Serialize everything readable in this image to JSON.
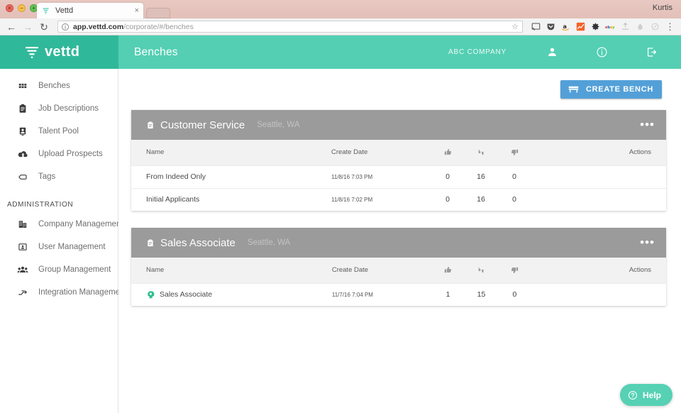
{
  "browser": {
    "profile_name": "Kurtis",
    "tab": {
      "title": "Vettd",
      "close_label": "×",
      "favicon": "vettd-favicon"
    },
    "new_tab_label": "",
    "nav": {
      "back": "←",
      "forward": "→",
      "reload": "↻"
    },
    "omnibox": {
      "info_label": "ⓘ",
      "url_host": "app.vettd.com",
      "url_path": "/corporate/#/benches",
      "star": "☆"
    },
    "extensions": [
      {
        "name": "cast-icon",
        "glyph": "ᵛ"
      },
      {
        "name": "pocket-icon",
        "glyph": "▼"
      },
      {
        "name": "amazon-icon",
        "glyph": "a"
      },
      {
        "name": "analytics-icon",
        "glyph": "↗"
      },
      {
        "name": "gear-icon",
        "glyph": "⚙"
      },
      {
        "name": "ebay-icon",
        "glyph": "ebay"
      },
      {
        "name": "upload-icon",
        "glyph": "⏏"
      },
      {
        "name": "drop-icon",
        "glyph": "●"
      },
      {
        "name": "circle-icon",
        "glyph": "○"
      }
    ],
    "menu_label": "⋮"
  },
  "appbar": {
    "brand_name": "vettd",
    "page_title": "Benches",
    "company": "ABC COMPANY",
    "icons": [
      {
        "name": "account-icon"
      },
      {
        "name": "info-icon"
      },
      {
        "name": "logout-icon"
      }
    ]
  },
  "sidebar": {
    "items": [
      {
        "label": "Benches",
        "icon": "grid-icon"
      },
      {
        "label": "Job Descriptions",
        "icon": "clipboard-icon"
      },
      {
        "label": "Talent Pool",
        "icon": "badge-icon"
      },
      {
        "label": "Upload Prospects",
        "icon": "cloud-upload-icon"
      },
      {
        "label": "Tags",
        "icon": "tag-icon"
      }
    ],
    "section_label": "ADMINISTRATION",
    "admin_items": [
      {
        "label": "Company Management",
        "icon": "building-icon"
      },
      {
        "label": "User Management",
        "icon": "contact-card-icon"
      },
      {
        "label": "Group Management",
        "icon": "people-icon"
      },
      {
        "label": "Integration Management",
        "icon": "merge-icon"
      }
    ]
  },
  "main": {
    "create_bench_label": "CREATE BENCH",
    "create_bench_icon": "bench-icon",
    "columns": {
      "name": "Name",
      "create_date": "Create Date",
      "thumbs_up": "thumbs-up-icon",
      "undecided": "undecided-icon",
      "thumbs_down": "thumbs-down-icon",
      "actions": "Actions"
    },
    "cards": [
      {
        "title": "Customer Service",
        "location": "Seattle, WA",
        "icon": "clipboard-icon",
        "menu": "•••",
        "rows": [
          {
            "name": "From Indeed Only",
            "date": "11/8/16 7:03 PM",
            "up": "0",
            "undecided": "16",
            "down": "0",
            "badge": null
          },
          {
            "name": "Initial Applicants",
            "date": "11/8/16 7:02 PM",
            "up": "0",
            "undecided": "16",
            "down": "0",
            "badge": null
          }
        ]
      },
      {
        "title": "Sales Associate",
        "location": "Seattle, WA",
        "icon": "clipboard-icon",
        "menu": "•••",
        "rows": [
          {
            "name": "Sales Associate",
            "date": "11/7/16 7:04 PM",
            "up": "1",
            "undecided": "15",
            "down": "0",
            "badge": "green-rosette-icon"
          }
        ]
      }
    ]
  },
  "help": {
    "label": "Help",
    "icon": "question-circle-icon"
  },
  "colors": {
    "brand_dark": "#30b89a",
    "brand": "#54cfb3",
    "primary_button": "#53a0d8",
    "card_header": "#9b9b9b",
    "help": "#56d1b4"
  }
}
